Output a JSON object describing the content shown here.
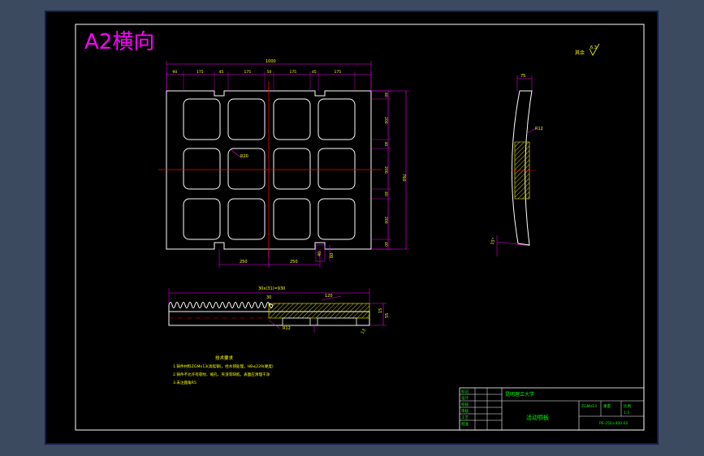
{
  "sheet": {
    "title": "A2横向",
    "roughness": "其余",
    "roughness_value": "6.3"
  },
  "front_view": {
    "overall_width": "1000",
    "top_dims": [
      "90",
      "175",
      "45",
      "175",
      "50",
      "175",
      "45",
      "175"
    ],
    "right_dims": [
      "40",
      "200",
      "40",
      "200",
      "40",
      "200",
      "40"
    ],
    "overall_height": "760",
    "radius": "R20",
    "bottom_dims": [
      "250",
      "250"
    ],
    "slot_dims": [
      "40",
      "60"
    ]
  },
  "bottom_view": {
    "tooth_dim": "30x(31)=930",
    "pitch": "30",
    "depth": "120",
    "chamfer": "R12",
    "side_dims": [
      "15",
      "55"
    ],
    "tooth_h": "13"
  },
  "side_view": {
    "top_dim": "75",
    "radius": "R12",
    "angle": "15°"
  },
  "notes": {
    "heading": "技术要求",
    "lines": [
      "1.铸件材料ZGMn13(高锰钢)，经水韧处理，HB≤229(硬度)",
      "2.铸件不允许有裂纹、缩孔、夹渣等缺陷，表面应清理干净",
      "3.未注圆角R5"
    ]
  },
  "title_block": {
    "part_name": "活动颚板",
    "drawing_no": "PE-250×400-02",
    "material": "ZGMn13",
    "scale": "1:5",
    "company": "昆明理工大学",
    "left_labels": [
      "标记",
      "设计",
      "校核",
      "审核",
      "工艺",
      "批准"
    ],
    "weight_label": "重量",
    "scale_label": "比例"
  },
  "colors": {
    "background": "#000000",
    "frame": "#ffffff",
    "dimension": "#ff00ff",
    "hatch": "#ffff00",
    "centerline": "#ff0000",
    "text_green": "#00ff00",
    "outer_bg": "#3b4a5f"
  }
}
